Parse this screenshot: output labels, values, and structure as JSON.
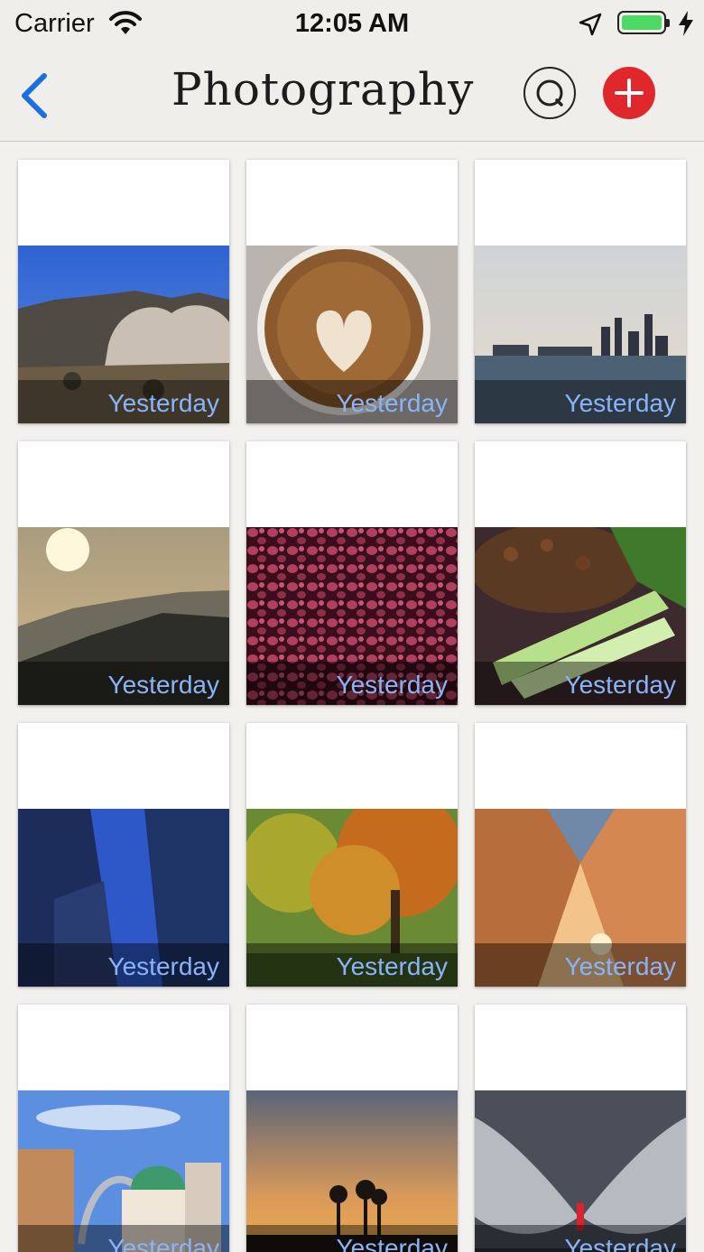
{
  "status_bar": {
    "carrier": "Carrier",
    "time": "12:05 AM",
    "battery_level": 1.0,
    "icons": [
      "wifi-icon",
      "location-arrow-icon",
      "battery-icon",
      "charging-bolt-icon"
    ]
  },
  "nav": {
    "title": "Photography",
    "back_icon": "chevron-left-icon",
    "search_icon": "search-icon",
    "add_icon": "plus-icon",
    "accent_color": "#1a6fe0",
    "add_color": "#e0272b"
  },
  "cards": [
    {
      "caption": "Yesterday",
      "scene": "desert-rocks"
    },
    {
      "caption": "Yesterday",
      "scene": "latte-art"
    },
    {
      "caption": "Yesterday",
      "scene": "city-skyline"
    },
    {
      "caption": "Yesterday",
      "scene": "hazy-sunset-hills"
    },
    {
      "caption": "Yesterday",
      "scene": "red-pebbles"
    },
    {
      "caption": "Yesterday",
      "scene": "noodle-dish"
    },
    {
      "caption": "Yesterday",
      "scene": "glass-towers"
    },
    {
      "caption": "Yesterday",
      "scene": "autumn-trees"
    },
    {
      "caption": "Yesterday",
      "scene": "tent-sunset"
    },
    {
      "caption": "Yesterday",
      "scene": "arch-and-dome"
    },
    {
      "caption": "Yesterday",
      "scene": "palm-sunset"
    },
    {
      "caption": "Yesterday",
      "scene": "wings-mural"
    }
  ]
}
